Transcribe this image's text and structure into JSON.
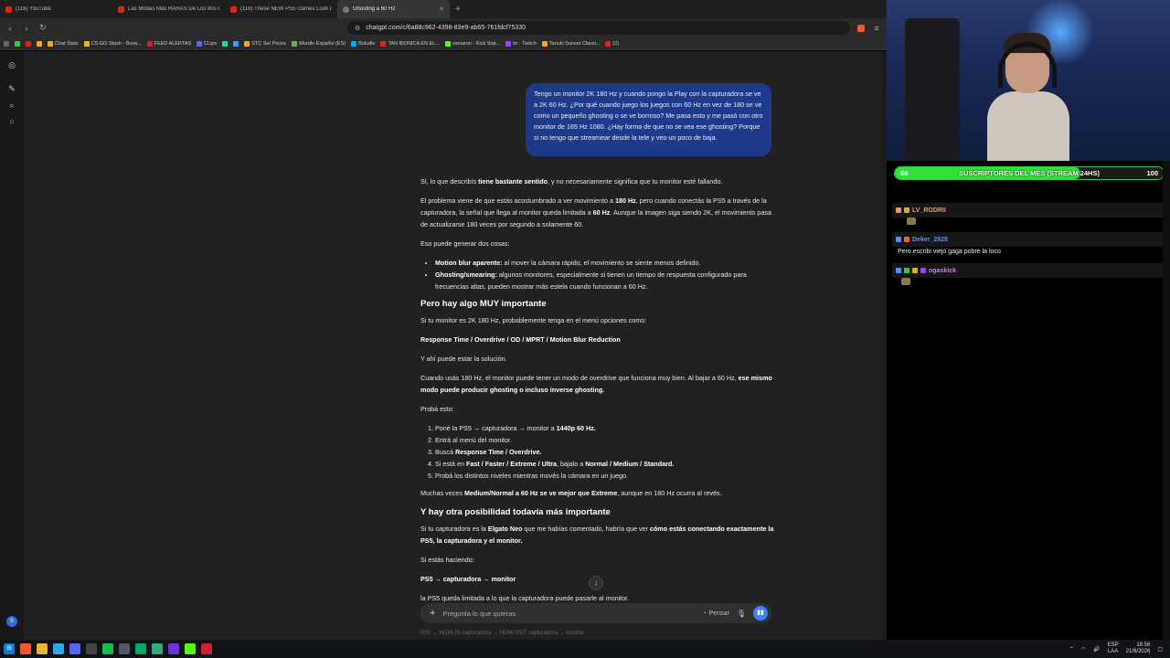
{
  "browser": {
    "tabs": [
      {
        "title": "(116) YouTube",
        "active": false
      },
      {
        "title": "Las Modas Más RARAS De Los 80s C...",
        "active": false
      },
      {
        "title": "(116) These NEW PS5 Games Look I...",
        "active": false
      },
      {
        "title": "Ghosting a 60 Hz",
        "active": true
      }
    ],
    "url": "chatgpt.com/c/6a88c962-4398-83e9-ab65-761fdcf75330",
    "bookmarks": [
      "Chat Stats",
      "CS:GO Stash - Brow...",
      "FEED ALERTAS",
      "CLips",
      "STC Set Prices",
      "Wordle Español (ES)",
      "Boludle",
      "TAN BIONICA EN EL...",
      "sionaron - Kick Stat...",
      "trr - Twitch",
      "Tanuki Sunset Classi...",
      "(2)"
    ]
  },
  "chat": {
    "user_message": "Tengo un monitor 2K 180 Hz y cuando pongo la Play con la capturadora se ve a 2K 60 Hz. ¿Por qué cuando juego los juegos con 60 Hz en vez de 180 se ve como un pequeño ghosting o se ve borroso? Me pasa esto y me pasó con otro monitor de 165 Hz 1080. ¿Hay forma de que no se vea ese ghosting? Porque si no tengo que streamear desde la tele y veo un poco de baja.",
    "a_p1_pre": "Sí, lo que describís ",
    "a_p1_b": "tiene bastante sentido",
    "a_p1_post": ", y no necesariamente significa que tu monitor esté fallando.",
    "a_p2_a": "El problema viene de que estás acostumbrado a ver movimiento a ",
    "a_p2_b1": "180 Hz",
    "a_p2_c": ", pero cuando conectás la PS5 a través de la capturadora, la señal que llega al monitor queda limitada a ",
    "a_p2_b2": "60 Hz",
    "a_p2_d": ". Aunque la imagen siga siendo 2K, el movimiento pasa de actualizarse 180 veces por segundo a solamente 60.",
    "a_p3": "Eso puede generar dos cosas:",
    "a_li1_b": "Motion blur aparente:",
    "a_li1": " al mover la cámara rápido, el movimiento se siente menos definido.",
    "a_li2_b": "Ghosting/smearing:",
    "a_li2": " algunos monitores, especialmente si tienen un tiempo de respuesta configurado para frecuencias altas, pueden mostrar más estela cuando funcionan a 60 Hz.",
    "a_h1": "Pero hay algo MUY importante",
    "a_p4": "Si tu monitor es 2K 180 Hz, probablemente tenga en el menú opciones como:",
    "a_p5": "Response Time / Overdrive / OD / MPRT / Motion Blur Reduction",
    "a_p6": "Y ahí puede estar la solución.",
    "a_p7_a": "Cuando usás 180 Hz, el monitor puede tener un modo de overdrive que funciona muy bien. Al bajar a 60 Hz, ",
    "a_p7_b": "ese mismo modo puede producir ghosting o incluso inverse ghosting.",
    "a_p8": "Probá esto:",
    "a_ol1_a": "Poné la PS5 → capturadora → monitor a ",
    "a_ol1_b": "1440p 60 Hz.",
    "a_ol2": "Entrá al menú del monitor.",
    "a_ol3_a": "Buscá ",
    "a_ol3_b": "Response Time / Overdrive.",
    "a_ol4_a": "Si está en ",
    "a_ol4_b": "Fast / Faster / Extreme / Ultra",
    "a_ol4_c": ", bajalo a ",
    "a_ol4_d": "Normal / Medium / Standard.",
    "a_ol5": "Probá los distintos niveles mientras movés la cámara en un juego.",
    "a_p9_a": "Muchas veces ",
    "a_p9_b": "Medium/Normal a 60 Hz se ve mejor que Extreme",
    "a_p9_c": ", aunque en 180 Hz ocurra al revés.",
    "a_h2": "Y hay otra posibilidad todavía más importante",
    "a_p10_a": "Si tu capturadora es la ",
    "a_p10_b": "Elgato Neo",
    "a_p10_c": " que me habías comentado, habría que ver ",
    "a_p10_d": "cómo estás conectando exactamente la PS5, la capturadora y el monitor.",
    "a_p11": "Si estás haciendo:",
    "a_p12": "PS5 → capturadora → monitor",
    "a_p13": "la PS5 queda limitada a lo que la capturadora puede pasarle al monitor.",
    "composer_placeholder": "Pregunta lo que quieras",
    "think_label": "Pensar",
    "footer_hint": "PS5 → HDMI IN capturadora → HDMI OUT capturadora → monitor"
  },
  "stream": {
    "sub_goal_label": "SUSCRIPTORES DEL MES (STREAM 24HS)",
    "sub_current": "69",
    "sub_goal": "100",
    "sub_progress_fraction": 0.69,
    "chat": [
      {
        "user": "LV_RODRII",
        "color": "#e0a060",
        "message": ""
      },
      {
        "user": "Deker_2828",
        "color": "#5a8cff",
        "message": "Pero escribi viejo gaga pobre la loco"
      },
      {
        "user": "ogaskick",
        "color": "#c77dff",
        "message": ""
      }
    ]
  },
  "taskbar": {
    "lang": "ESP",
    "lang2": "LAA",
    "time": "18:56",
    "date": "21/8/2026"
  },
  "colors": {
    "user_bubble": "#1e3a8a",
    "accent_blue": "#3b82f6",
    "sub_bar_green": "#32e03c"
  }
}
